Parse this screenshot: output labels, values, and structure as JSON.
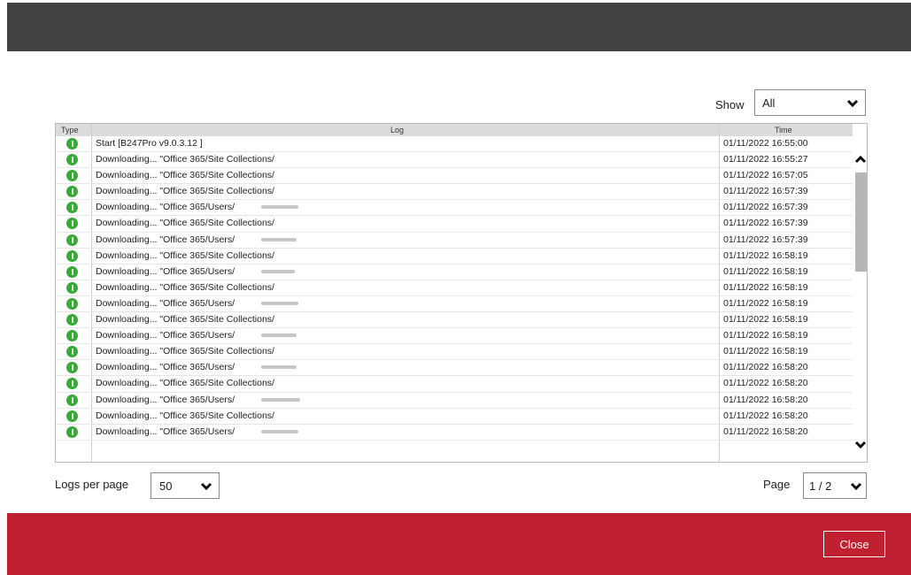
{
  "dialog": {
    "show_label": "Show",
    "show_value": "All",
    "logs_per_page_label": "Logs per page",
    "logs_per_page_value": "50",
    "page_label": "Page",
    "page_value": "1 / 2",
    "close_label": "Close"
  },
  "table": {
    "headers": {
      "type": "Type",
      "log": "Log",
      "time": "Time"
    },
    "rows": [
      {
        "log": "Start [B247Pro v9.0.3.12 ]",
        "time": "01/11/2022 16:55:00"
      },
      {
        "log": "Downloading... \"Office 365/Site Collections/",
        "time": "01/11/2022 16:55:27"
      },
      {
        "log": "Downloading... \"Office 365/Site Collections/",
        "time": "01/11/2022 16:57:05"
      },
      {
        "log": "Downloading... \"Office 365/Site Collections/",
        "time": "01/11/2022 16:57:39"
      },
      {
        "log": "Downloading... \"Office 365/Users/",
        "time": "01/11/2022 16:57:39"
      },
      {
        "log": "Downloading... \"Office 365/Site Collections/",
        "time": "01/11/2022 16:57:39"
      },
      {
        "log": "Downloading... \"Office 365/Users/",
        "time": "01/11/2022 16:57:39"
      },
      {
        "log": "Downloading... \"Office 365/Site Collections/",
        "time": "01/11/2022 16:58:19"
      },
      {
        "log": "Downloading... \"Office 365/Users/",
        "time": "01/11/2022 16:58:19"
      },
      {
        "log": "Downloading... \"Office 365/Site Collections/",
        "time": "01/11/2022 16:58:19"
      },
      {
        "log": "Downloading... \"Office 365/Users/",
        "time": "01/11/2022 16:58:19"
      },
      {
        "log": "Downloading... \"Office 365/Site Collections/",
        "time": "01/11/2022 16:58:19"
      },
      {
        "log": "Downloading... \"Office 365/Users/",
        "time": "01/11/2022 16:58:19"
      },
      {
        "log": "Downloading... \"Office 365/Site Collections/",
        "time": "01/11/2022 16:58:19"
      },
      {
        "log": "Downloading... \"Office 365/Users/",
        "time": "01/11/2022 16:58:20"
      },
      {
        "log": "Downloading... \"Office 365/Site Collections/",
        "time": "01/11/2022 16:58:20"
      },
      {
        "log": "Downloading... \"Office 365/Users/",
        "time": "01/11/2022 16:58:20"
      },
      {
        "log": "Downloading... \"Office 365/Site Collections/",
        "time": "01/11/2022 16:58:20"
      },
      {
        "log": "Downloading... \"Office 365/Users/",
        "time": "01/11/2022 16:58:20"
      }
    ]
  },
  "colors": {
    "titlebar": "#424242",
    "footer": "#c0202f",
    "info_icon": "#39a935"
  },
  "icons": {
    "row_type": "info-icon",
    "select": "chevron-down-icon",
    "scroll_up": "chevron-up-icon",
    "scroll_down": "chevron-down-icon"
  }
}
